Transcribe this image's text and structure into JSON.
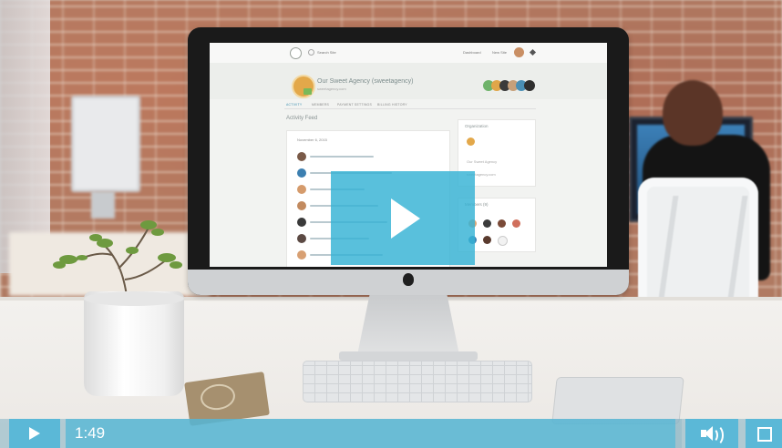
{
  "player": {
    "current_time": "1:49",
    "progress_fraction": 0.99,
    "accent_color": "#5bb8d7"
  },
  "screen_site": {
    "search_placeholder": "Search Site",
    "nav_links": [
      "Dashboard",
      "New Site"
    ],
    "org_name": "Our Sweet Agency (sweetagency)",
    "org_url": "sweetagency.com",
    "tabs": [
      "Activity",
      "Members",
      "Payment Settings",
      "Billing History"
    ],
    "activity_title": "Activity Feed",
    "feed_date": "November 6, 2015",
    "side_title": "Organization",
    "side_name": "Our Sweet Agency",
    "side_url": "sweetagency.com",
    "side2_title": "Members (9)"
  },
  "icons": {
    "big_play": "play-icon",
    "small_play": "play-icon",
    "volume": "speaker-icon",
    "fullscreen": "fullscreen-icon"
  }
}
